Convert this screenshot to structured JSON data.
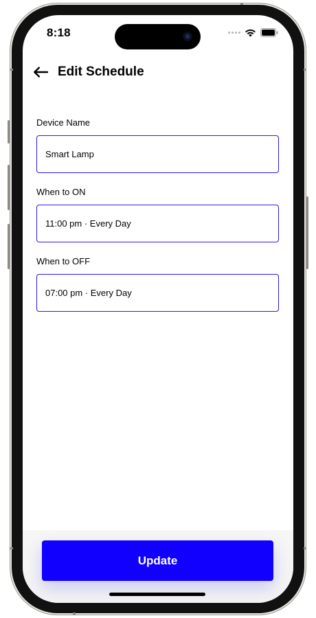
{
  "status_bar": {
    "time": "8:18"
  },
  "header": {
    "back_icon": "arrow-left-icon",
    "title": "Edit Schedule"
  },
  "form": {
    "device_name": {
      "label": "Device Name",
      "value": "Smart Lamp"
    },
    "when_on": {
      "label": "When to ON",
      "value": "11:00 pm · Every Day"
    },
    "when_off": {
      "label": "When to OFF",
      "value": "07:00 pm · Every Day"
    }
  },
  "actions": {
    "update_label": "Update"
  },
  "colors": {
    "accent": "#1200ff",
    "field_border": "#2c16e8"
  }
}
